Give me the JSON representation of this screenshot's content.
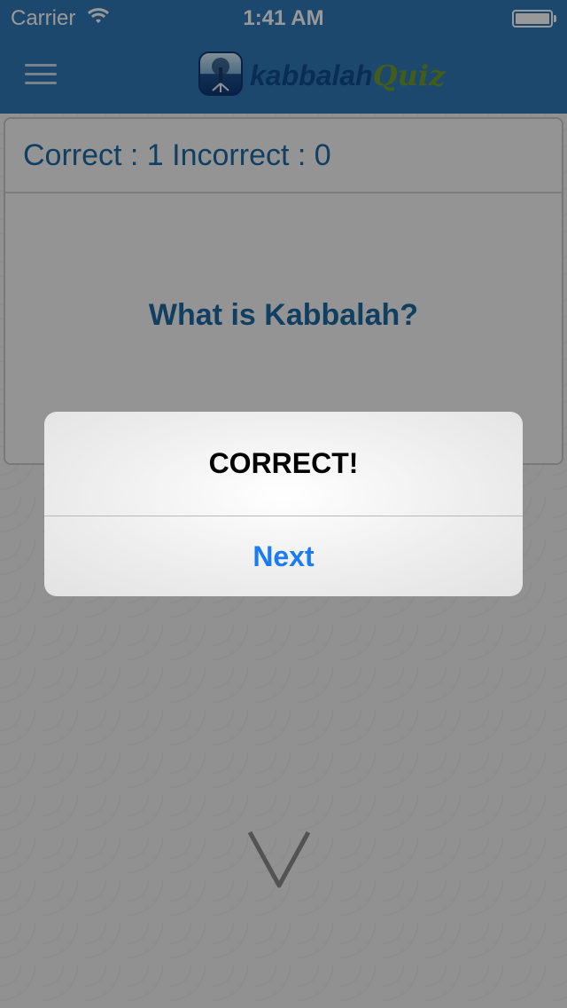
{
  "status_bar": {
    "carrier": "Carrier",
    "time": "1:41 AM"
  },
  "nav": {
    "logo_word1": "kabbalah",
    "logo_word2": "Quiz",
    "brand_color": "#2f78b7"
  },
  "quiz": {
    "score_text": "Correct : 1 Incorrect : 0",
    "question": "What is Kabbalah?"
  },
  "alert": {
    "title": "CORRECT!",
    "button_label": "Next",
    "button_color": "#1a7cf0"
  },
  "icons": {
    "menu": "hamburger-menu-icon",
    "wifi": "wifi-icon",
    "battery": "battery-icon",
    "arrow": "arrow-down-icon",
    "logo": "tree-of-life-icon"
  }
}
